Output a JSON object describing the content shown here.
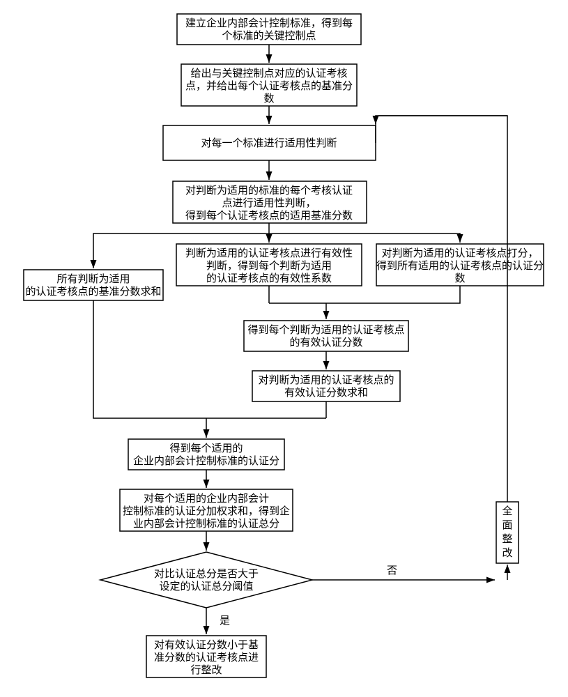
{
  "nodes": {
    "n1": {
      "lines": [
        "建立企业内部会计控制标准，得到每",
        "个标准的关键控制点"
      ]
    },
    "n2": {
      "lines": [
        "给出与关键控制点对应的认证考核",
        "点，并给出每个认证考核点的基准分",
        "数"
      ]
    },
    "n3": {
      "lines": [
        "对每一个标准进行适用性判断"
      ]
    },
    "n4": {
      "lines": [
        "对判断为适用的标准的每个考核认证",
        "点进行适用性判断，",
        "得到每个认证考核点的适用基准分数"
      ]
    },
    "n5a": {
      "lines": [
        "所有判断为适用",
        "的认证考核点的基准分数求和"
      ]
    },
    "n5b": {
      "lines": [
        "判断为适用的认证考核点进行有效性",
        "判断，得到每个判断为适用",
        "的认证考核点的有效性系数"
      ]
    },
    "n5c": {
      "lines": [
        "对判断为适用的认证考核点打分，",
        "得到所有适用的认证考核点的认证分",
        "数"
      ]
    },
    "n6": {
      "lines": [
        "得到每个判断为适用的认证考核点",
        "的有效认证分数"
      ]
    },
    "n7": {
      "lines": [
        "对判断为适用的认证考核点的",
        "有效认证分数求和"
      ]
    },
    "n8": {
      "lines": [
        "得到每个适用的",
        "企业内部会计控制标准的认证分"
      ]
    },
    "n9": {
      "lines": [
        "对每个适用的企业内部会计",
        "控制标准的认证分加权求和，得到企",
        "业内部会计控制标准的认证总分"
      ]
    },
    "decision": {
      "lines": [
        "对比认证总分是否大于",
        "设定的认证总分阈值"
      ]
    },
    "n10": {
      "lines": [
        "对有效认证分数小于基",
        "准分数的认证考核点进",
        "行整改"
      ]
    },
    "side": {
      "lines": [
        "全",
        "面",
        "整",
        "改"
      ]
    }
  },
  "edges": {
    "yes": "是",
    "no": "否"
  }
}
